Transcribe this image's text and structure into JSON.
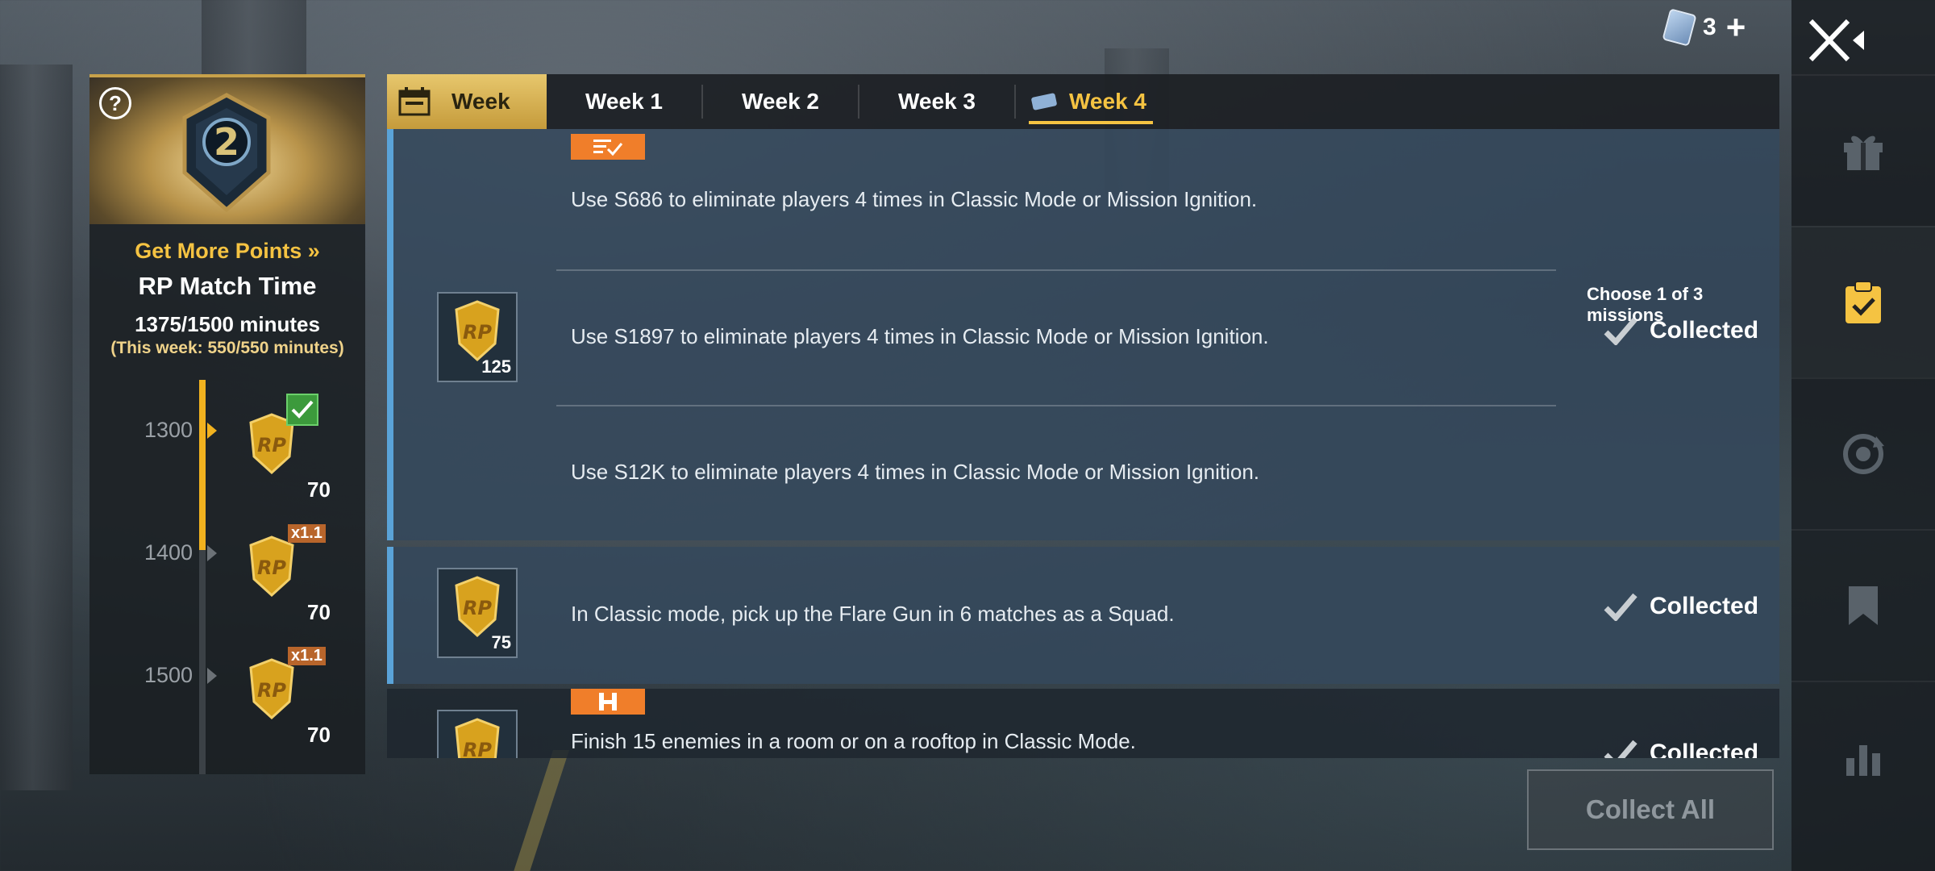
{
  "header": {
    "currency_count": "3",
    "plus_label": "+",
    "ticket_icon": "ticket-icon"
  },
  "left_panel": {
    "help_label": "?",
    "season_number": "2",
    "get_more_points": "Get More Points",
    "match_title": "RP Match Time",
    "match_minutes": "1375/1500 minutes",
    "match_week": "(This week: 550/550 minutes)",
    "progress_fraction": 0.917,
    "milestones": [
      {
        "label": "1300",
        "value": "70",
        "claimed": true,
        "multiplier": ""
      },
      {
        "label": "1400",
        "value": "70",
        "claimed": false,
        "multiplier": "x1.1"
      },
      {
        "label": "1500",
        "value": "70",
        "claimed": false,
        "multiplier": "x1.1"
      }
    ]
  },
  "tabs": [
    {
      "label": "Week",
      "state": "header"
    },
    {
      "label": "Week 1",
      "state": "normal"
    },
    {
      "label": "Week 2",
      "state": "normal"
    },
    {
      "label": "Week 3",
      "state": "normal"
    },
    {
      "label": "Week 4",
      "state": "active"
    }
  ],
  "missions": {
    "group1": {
      "reward_amount": "125",
      "choose_text": "Choose 1 of 3 missions",
      "status": "Collected",
      "items": [
        "Use S686 to eliminate players 4 times in Classic Mode or Mission Ignition.",
        "Use S1897 to eliminate players 4 times in Classic Mode or Mission Ignition.",
        "Use S12K to eliminate players 4 times in Classic Mode or Mission Ignition."
      ]
    },
    "mission2": {
      "reward_amount": "75",
      "text": "In Classic mode, pick up the Flare Gun in 6 matches as a Squad.",
      "status": "Collected"
    },
    "mission3": {
      "text": "Finish 15 enemies in a room or on a rooftop in Classic Mode.",
      "status": "Collected"
    }
  },
  "collect_all_label": "Collect All",
  "colors": {
    "accent_gold": "#f5c342",
    "card_blue": "#34485c",
    "tag_orange": "#f07e2a"
  }
}
